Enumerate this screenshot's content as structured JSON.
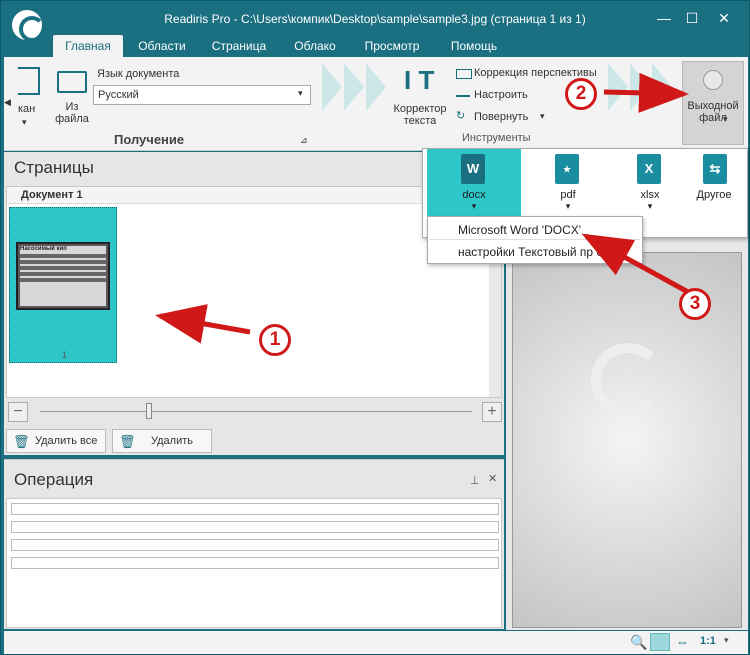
{
  "window": {
    "title": "Readiris Pro - C:\\Users\\компик\\Desktop\\sample\\sample3.jpg (страница 1 из 1)",
    "minimize": "—",
    "maximize": "☐",
    "close": "✕"
  },
  "menu": {
    "tabs": [
      "Главная",
      "Области",
      "Страница",
      "Облако",
      "Просмотр",
      "Помощь"
    ]
  },
  "ribbon": {
    "scan_label": "кан",
    "from_file_label": "Из\nфайла",
    "language_label": "Язык документа",
    "language_value": "Русский",
    "group_acquire": "Получение",
    "corrector_label": "Корректор\nтекста",
    "perspective_label": "Коррекция перспективы",
    "adjust_label": "Настроить",
    "rotate_label": "Повернуть",
    "group_tools": "Инструменты",
    "output_label": "Выходной\nфайл"
  },
  "pages_panel": {
    "title": "Страницы",
    "document_label": "Документ 1",
    "page_number": "1",
    "thumb_heading": "Насосимый кип",
    "thumb_lines": [
      "Описывание на дорожках ..."
    ],
    "delete_all": "Удалить все",
    "delete": "Удалить"
  },
  "operation_panel": {
    "title": "Операция"
  },
  "output_dropdown": {
    "formats": [
      {
        "label": "docx",
        "letter": "W"
      },
      {
        "label": "pdf",
        "letter": "⭑"
      },
      {
        "label": "xlsx",
        "letter": "X"
      },
      {
        "label": "Другое",
        "letter": "⇆"
      }
    ],
    "menu_items": [
      "Microsoft Word 'DOCX'",
      "настройки Текстовый пр   ссор"
    ]
  },
  "statusbar": {
    "zoom_label": "1:1"
  },
  "callouts": [
    "1",
    "2",
    "3"
  ],
  "colors": {
    "accent": "#1a6f80",
    "selected": "#2ec7c9",
    "arrow": "#d01818"
  }
}
